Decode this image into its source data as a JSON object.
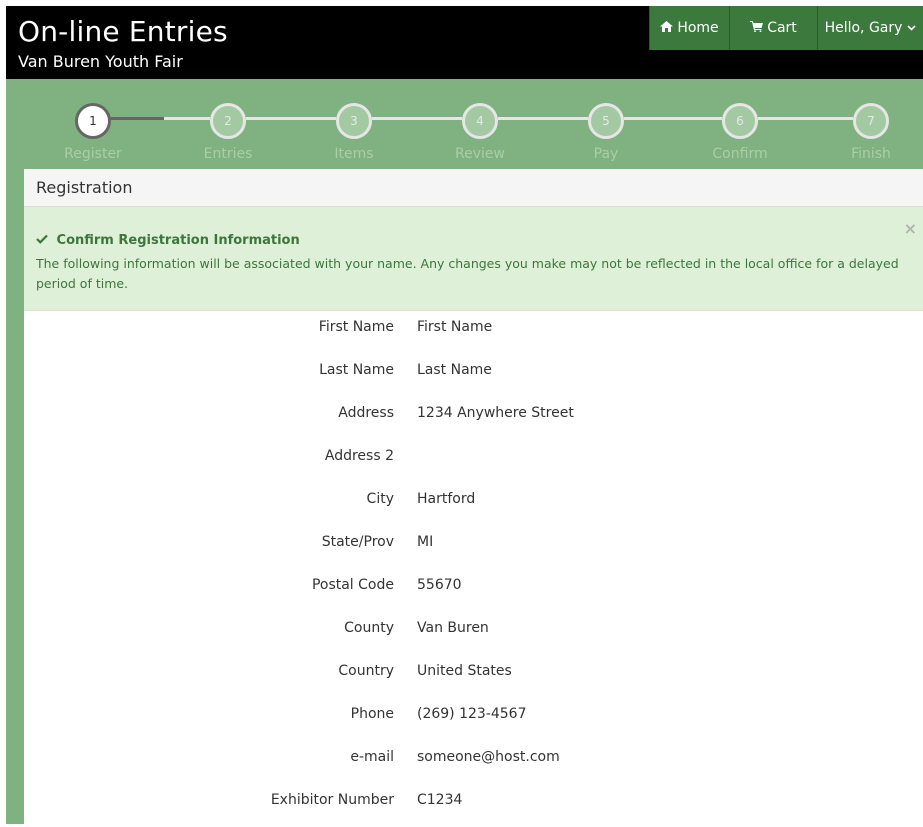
{
  "header": {
    "title": "On-line Entries",
    "subtitle": "Van Buren Youth Fair",
    "nav": {
      "home": "Home",
      "cart": "Cart",
      "user": "Hello, Gary"
    }
  },
  "wizard": {
    "steps": [
      {
        "num": "1",
        "label": "Register"
      },
      {
        "num": "2",
        "label": "Entries"
      },
      {
        "num": "3",
        "label": "Items"
      },
      {
        "num": "4",
        "label": "Review"
      },
      {
        "num": "5",
        "label": "Pay"
      },
      {
        "num": "6",
        "label": "Confirm"
      },
      {
        "num": "7",
        "label": "Finish"
      }
    ]
  },
  "panel": {
    "heading": "Registration",
    "alert": {
      "title": "Confirm Registration Information",
      "message": "The following information will be associated with your name. Any changes you make may not be reflected in the local office for a delayed period of time.",
      "close": "×"
    },
    "fields": [
      {
        "label": "First Name",
        "value": "First Name"
      },
      {
        "label": "Last Name",
        "value": "Last Name"
      },
      {
        "label": "Address",
        "value": "1234 Anywhere Street"
      },
      {
        "label": "Address 2",
        "value": ""
      },
      {
        "label": "City",
        "value": "Hartford"
      },
      {
        "label": "State/Prov",
        "value": "MI"
      },
      {
        "label": "Postal Code",
        "value": "55670"
      },
      {
        "label": "County",
        "value": "Van Buren"
      },
      {
        "label": "Country",
        "value": "United States"
      },
      {
        "label": "Phone",
        "value": "(269) 123-4567"
      },
      {
        "label": "e-mail",
        "value": "someone@host.com"
      },
      {
        "label": "Exhibitor Number",
        "value": "C1234"
      }
    ]
  },
  "colors": {
    "header_bg": "#000000",
    "nav_bg": "#3b7a3c",
    "page_green": "#80b180",
    "alert_bg": "#dff0d8",
    "alert_text": "#3c763d"
  }
}
